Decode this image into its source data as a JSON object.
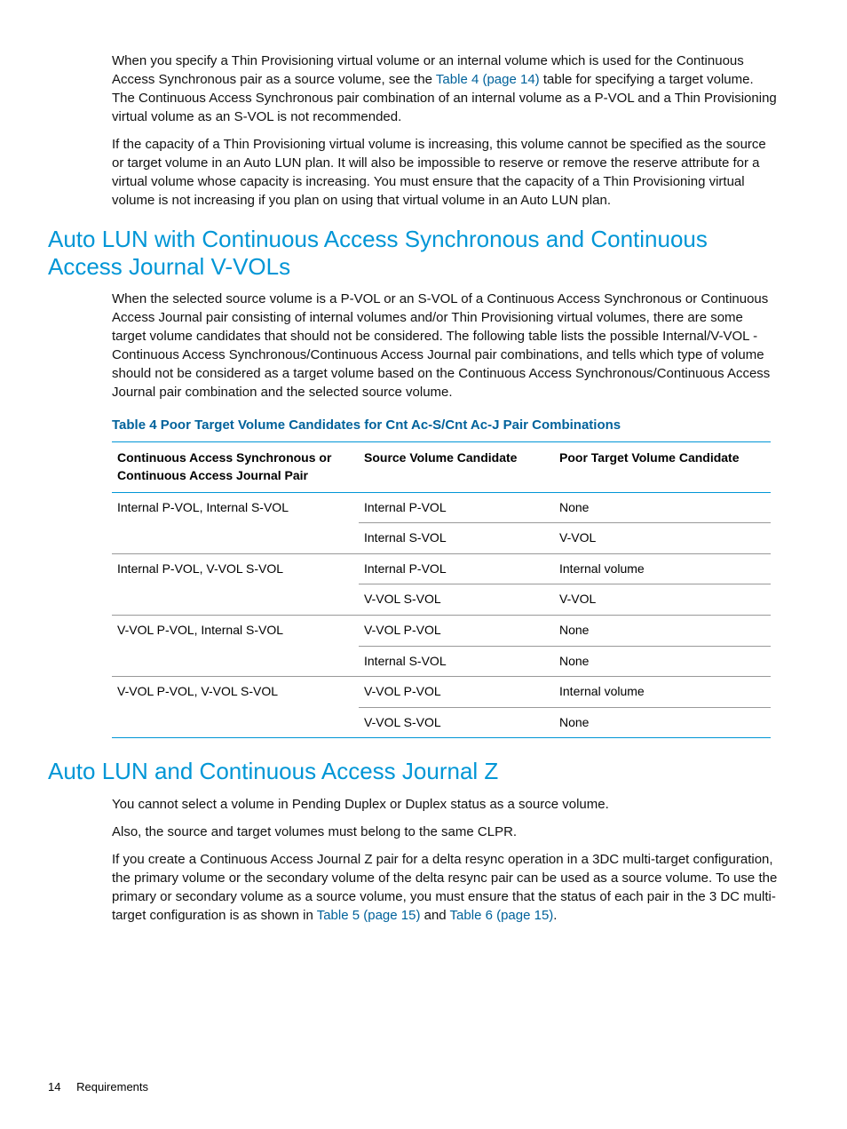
{
  "para1_a": "When you specify a Thin Provisioning virtual volume or an internal volume which is used for the Continuous Access Synchronous pair as a source volume, see the ",
  "para1_link": "Table 4 (page 14)",
  "para1_b": " table for specifying a target volume. The Continuous Access Synchronous pair combination of an internal volume as a P-VOL and a Thin Provisioning virtual volume as an S-VOL is not recommended.",
  "para2": "If the capacity of a Thin Provisioning virtual volume is increasing, this volume cannot be specified as the source or target volume in an Auto LUN plan. It will also be impossible to reserve or remove the reserve attribute for a virtual volume whose capacity is increasing. You must ensure that the capacity of a Thin Provisioning virtual volume is not increasing if you plan on using that virtual volume in an Auto LUN plan.",
  "heading1": "Auto LUN with Continuous Access Synchronous and Continuous Access Journal V-VOLs",
  "para3": "When the selected source volume is a P-VOL or an S-VOL of a Continuous Access Synchronous or Continuous Access Journal pair consisting of internal volumes and/or Thin Provisioning virtual volumes, there are some target volume candidates that should not be considered. The following table lists the possible Internal/V-VOL - Continuous Access Synchronous/Continuous Access Journal pair combinations, and tells which type of volume should not be considered as a target volume based on the Continuous Access Synchronous/Continuous Access Journal pair combination and the selected source volume.",
  "table_caption": "Table 4 Poor Target Volume Candidates for Cnt Ac-S/Cnt Ac-J Pair Combinations",
  "table": {
    "headers": {
      "c1": "Continuous Access Synchronous or Continuous Access Journal Pair",
      "c2": "Source Volume Candidate",
      "c3": "Poor Target Volume Candidate"
    },
    "rows": [
      {
        "c1": "Internal P-VOL, Internal S-VOL",
        "c2": "Internal P-VOL",
        "c3": "None",
        "group_top": true
      },
      {
        "c1": "",
        "c2": "Internal S-VOL",
        "c3": "V-VOL"
      },
      {
        "c1": "Internal P-VOL, V-VOL S-VOL",
        "c2": "Internal P-VOL",
        "c3": "Internal volume",
        "group_top": true
      },
      {
        "c1": "",
        "c2": "V-VOL S-VOL",
        "c3": "V-VOL"
      },
      {
        "c1": "V-VOL P-VOL, Internal S-VOL",
        "c2": "V-VOL P-VOL",
        "c3": "None",
        "group_top": true
      },
      {
        "c1": "",
        "c2": "Internal S-VOL",
        "c3": "None"
      },
      {
        "c1": "V-VOL P-VOL, V-VOL S-VOL",
        "c2": "V-VOL P-VOL",
        "c3": "Internal volume",
        "group_top": true
      },
      {
        "c1": "",
        "c2": "V-VOL S-VOL",
        "c3": "None"
      }
    ]
  },
  "heading2": "Auto LUN and Continuous Access Journal Z",
  "para4": "You cannot select a volume in Pending Duplex or Duplex status as a source volume.",
  "para5": "Also, the source and target volumes must belong to the same CLPR.",
  "para6_a": "If you create a Continuous Access Journal Z pair for a delta resync operation in a 3DC multi-target configuration, the primary volume or the secondary volume of the delta resync pair can be used as a source volume. To use the primary or secondary volume as a source volume, you must ensure that the status of each pair in the 3 DC multi-target configuration is as shown in ",
  "para6_link1": "Table 5 (page 15)",
  "para6_mid": " and ",
  "para6_link2": "Table 6 (page 15)",
  "para6_end": ".",
  "footer": {
    "page": "14",
    "section": "Requirements"
  }
}
